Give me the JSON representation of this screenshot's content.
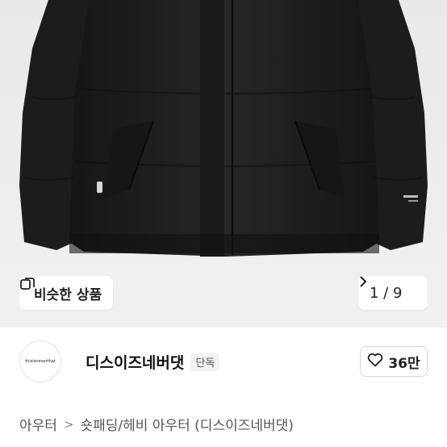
{
  "gallery": {
    "similar_label": "비슷한 상품",
    "similar_icon": "copy-squares-icon",
    "pager_text": "1 / 9",
    "pager_icon": "chevron-right-icon",
    "colors": {
      "background": "#ececee",
      "jacket": "#1f1f21"
    }
  },
  "shop": {
    "logo_text": "thisisneverthat",
    "name": "디스이즈네버댓",
    "badge": "단독",
    "like_icon": "heart-outline-icon",
    "like_count": "36만"
  },
  "breadcrumb": {
    "items": [
      "아우터",
      "숏패딩/헤비 아우터 (디스이즈네버댓)"
    ],
    "separator": ">"
  }
}
